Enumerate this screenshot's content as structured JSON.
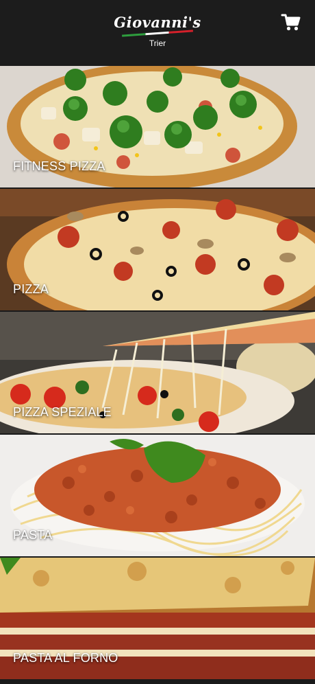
{
  "header": {
    "brand": "Giovanni's",
    "city": "Trier",
    "cart_icon": "cart-icon"
  },
  "categories": [
    {
      "label": "FITNESS PIZZA"
    },
    {
      "label": "PIZZA"
    },
    {
      "label": "PIZZA SPEZIALE"
    },
    {
      "label": "PASTA"
    },
    {
      "label": "PASTA AL FORNO"
    }
  ],
  "colors": {
    "header_bg": "#1c1c1c",
    "flag_green": "#2e9e3e",
    "flag_white": "#ffffff",
    "flag_red": "#d4202a"
  }
}
